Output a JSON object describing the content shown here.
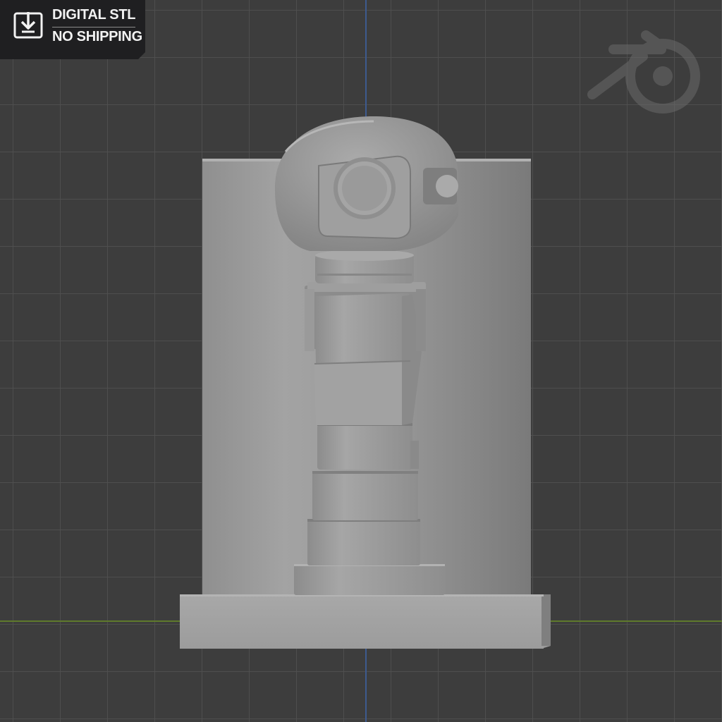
{
  "badge": {
    "line1": "DIGITAL STL",
    "line2": "NO SHIPPING",
    "icon": "download-box-icon"
  },
  "viewport": {
    "background": "#3d3d3d",
    "grid_color": "#505050",
    "axis_y_color": "#3d5a8f",
    "axis_x_color": "#5f7a2c",
    "watermark_icon": "blender-logo-icon"
  },
  "model": {
    "subject": "robot figure relief on cylindrical backdrop with rectangular base",
    "material_color": "#9a9a9a"
  }
}
